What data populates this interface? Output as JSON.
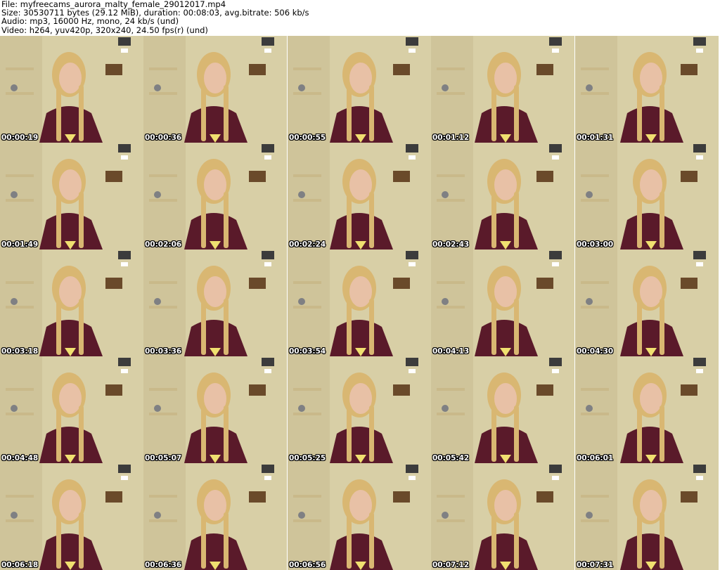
{
  "header": {
    "file": "File: myfreecams_aurora_malty_female_29012017.mp4",
    "size": "Size: 30530711 bytes (29.12 MiB), duration: 00:08:03, avg.bitrate: 506 kb/s",
    "audio": "Audio: mp3, 16000 Hz, mono, 24 kb/s (und)",
    "video": "Video: h264, yuv420p, 320x240, 24.50 fps(r) (und)"
  },
  "thumbnails": [
    {
      "timestamp": "00:00:19"
    },
    {
      "timestamp": "00:00:36"
    },
    {
      "timestamp": "00:00:55"
    },
    {
      "timestamp": "00:01:12"
    },
    {
      "timestamp": "00:01:31"
    },
    {
      "timestamp": "00:01:49"
    },
    {
      "timestamp": "00:02:06"
    },
    {
      "timestamp": "00:02:24"
    },
    {
      "timestamp": "00:02:43"
    },
    {
      "timestamp": "00:03:00"
    },
    {
      "timestamp": "00:03:18"
    },
    {
      "timestamp": "00:03:36"
    },
    {
      "timestamp": "00:03:54"
    },
    {
      "timestamp": "00:04:13"
    },
    {
      "timestamp": "00:04:30"
    },
    {
      "timestamp": "00:04:48"
    },
    {
      "timestamp": "00:05:07"
    },
    {
      "timestamp": "00:05:25"
    },
    {
      "timestamp": "00:05:42"
    },
    {
      "timestamp": "00:06:01"
    },
    {
      "timestamp": "00:06:18"
    },
    {
      "timestamp": "00:06:36"
    },
    {
      "timestamp": "00:06:56"
    },
    {
      "timestamp": "00:07:12"
    },
    {
      "timestamp": "00:07:31"
    }
  ],
  "colors": {
    "wall": "#d8cfa6",
    "shirt": "#5a1a2a",
    "hair": "#d9b772",
    "skin": "#e8c1a6",
    "shelf": "#c9b98a"
  }
}
